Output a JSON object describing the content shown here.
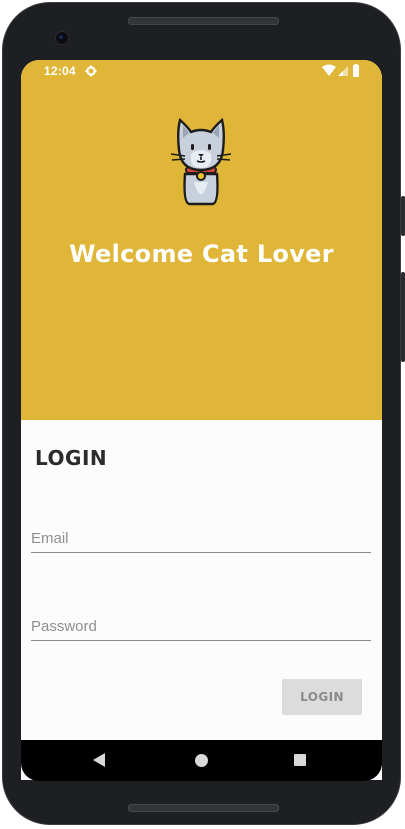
{
  "status_bar": {
    "time": "12:04",
    "icons": [
      "gear-icon",
      "wifi-icon",
      "signal-icon",
      "battery-icon"
    ]
  },
  "header": {
    "logo": "cat-icon",
    "title": "Welcome Cat Lover",
    "background_color": "#dfb637"
  },
  "login_form": {
    "heading": "LOGIN",
    "email": {
      "placeholder": "Email",
      "value": ""
    },
    "password": {
      "placeholder": "Password",
      "value": ""
    },
    "submit_label": "LOGIN"
  },
  "nav_bar": {
    "buttons": [
      "back-icon",
      "home-icon",
      "recents-icon"
    ]
  }
}
